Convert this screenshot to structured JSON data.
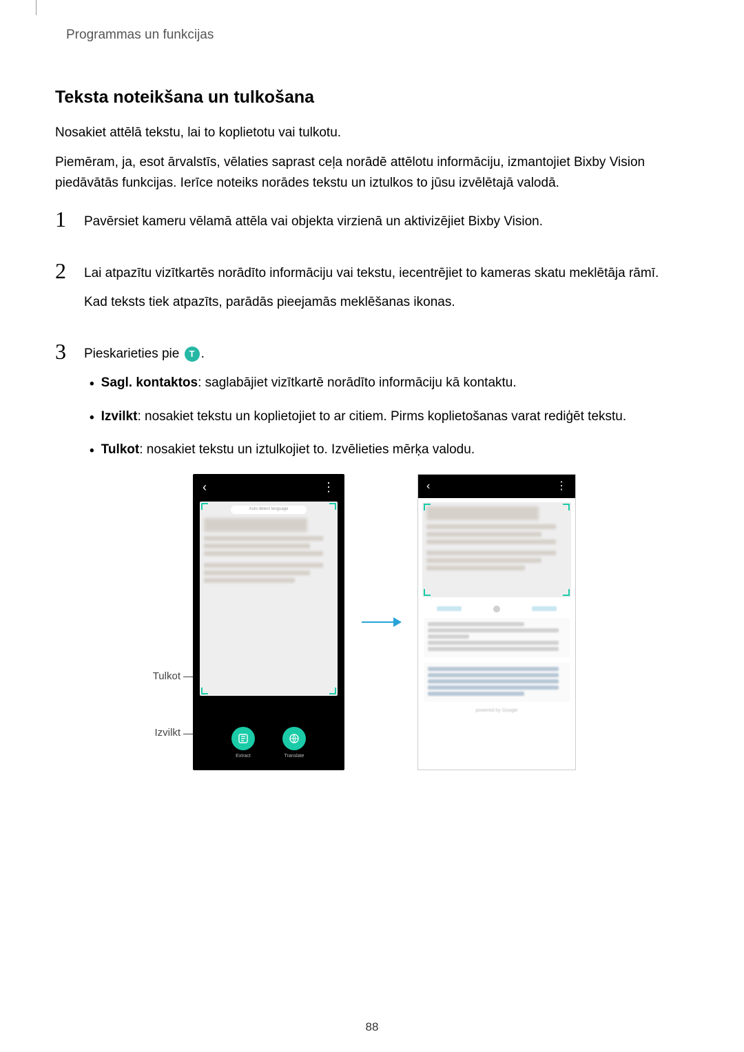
{
  "header_label": "Programmas un funkcijas",
  "heading": "Teksta noteikšana un tulkošana",
  "intro1": "Nosakiet attēlā tekstu, lai to koplietotu vai tulkotu.",
  "intro2": "Piemēram, ja, esot ārvalstīs, vēlaties saprast ceļa norādē attēlotu informāciju, izmantojiet Bixby Vision piedāvātās funkcijas. Ierīce noteiks norādes tekstu un iztulkos to jūsu izvēlētajā valodā.",
  "steps": {
    "s1": "Pavērsiet kameru vēlamā attēla vai objekta virzienā un aktivizējiet Bixby Vision.",
    "s2a": "Lai atpazītu vizītkartēs norādīto informāciju vai tekstu, iecentrējiet to kameras skatu meklētāja rāmī.",
    "s2b": "Kad teksts tiek atpazīts, parādās pieejamās meklēšanas ikonas.",
    "s3_pre": "Pieskarieties pie",
    "s3_icon": "T",
    "s3_post": "."
  },
  "bullets": {
    "b1_label": "Sagl. kontaktos",
    "b1_text": ": saglabājiet vizītkartē norādīto informāciju kā kontaktu.",
    "b2_label": "Izvilkt",
    "b2_text": ": nosakiet tekstu un koplietojiet to ar citiem. Pirms koplietošanas varat rediģēt tekstu.",
    "b3_label": "Tulkot",
    "b3_text": ": nosakiet tekstu un iztulkojiet to. Izvēlieties mērķa valodu."
  },
  "illus": {
    "leftLabels": {
      "translate": "Tulkot",
      "extract": "Izvilkt"
    },
    "detect_pill": "Auto detect language",
    "back_glyph": "‹",
    "more_glyph": "⋮",
    "action_extract": "Extract",
    "action_translate": "Translate",
    "credit": "powered by Google"
  },
  "page_number": "88"
}
